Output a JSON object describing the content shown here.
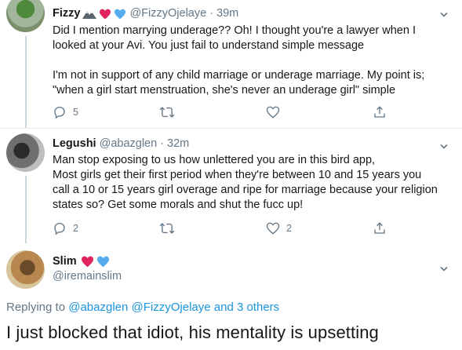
{
  "tweets": [
    {
      "name": "Fizzy",
      "handle": "@FizzyOjelaye",
      "time": "39m",
      "lines": [
        "Did I mention marrying underage?? Oh! I thought you're a lawyer when I",
        "looked at your Avi. You just fail to understand simple message",
        "",
        "I'm not in support of any child marriage or underage marriage. My point is;",
        "\"when a girl start menstruation, she's never an underage girl\" simple"
      ],
      "replies": "5",
      "retweets": "",
      "likes": ""
    },
    {
      "name": "Legushi",
      "handle": "@abazglen",
      "time": "32m",
      "lines": [
        "Man stop exposing to us how unlettered you are in this bird app,",
        "Most girls get their first period when they're between 10 and 15 years you",
        "call a 10 or 15 years girl overage and ripe for marriage because your religion",
        "states so? Get some morals and shut the fucc up!"
      ],
      "replies": "2",
      "retweets": "",
      "likes": "2"
    }
  ],
  "focus": {
    "name": "Slim",
    "handle": "@iremainslim",
    "replying_prefix": "Replying to ",
    "replying_users": "@abazglen @FizzyOjelaye",
    "replying_suffix": " and 3 others",
    "text": "I just blocked that idiot, his mentality is upsetting"
  },
  "colors": {
    "heart": "#e0245e",
    "blue_heart": "#55acee",
    "link": "#1b95e0",
    "muted": "#657786"
  },
  "icons": [
    "reply-icon",
    "retweet-icon",
    "like-icon",
    "share-icon",
    "caret-down-icon",
    "heart-emoji",
    "blue-heart-emoji",
    "mountain-emoji"
  ]
}
